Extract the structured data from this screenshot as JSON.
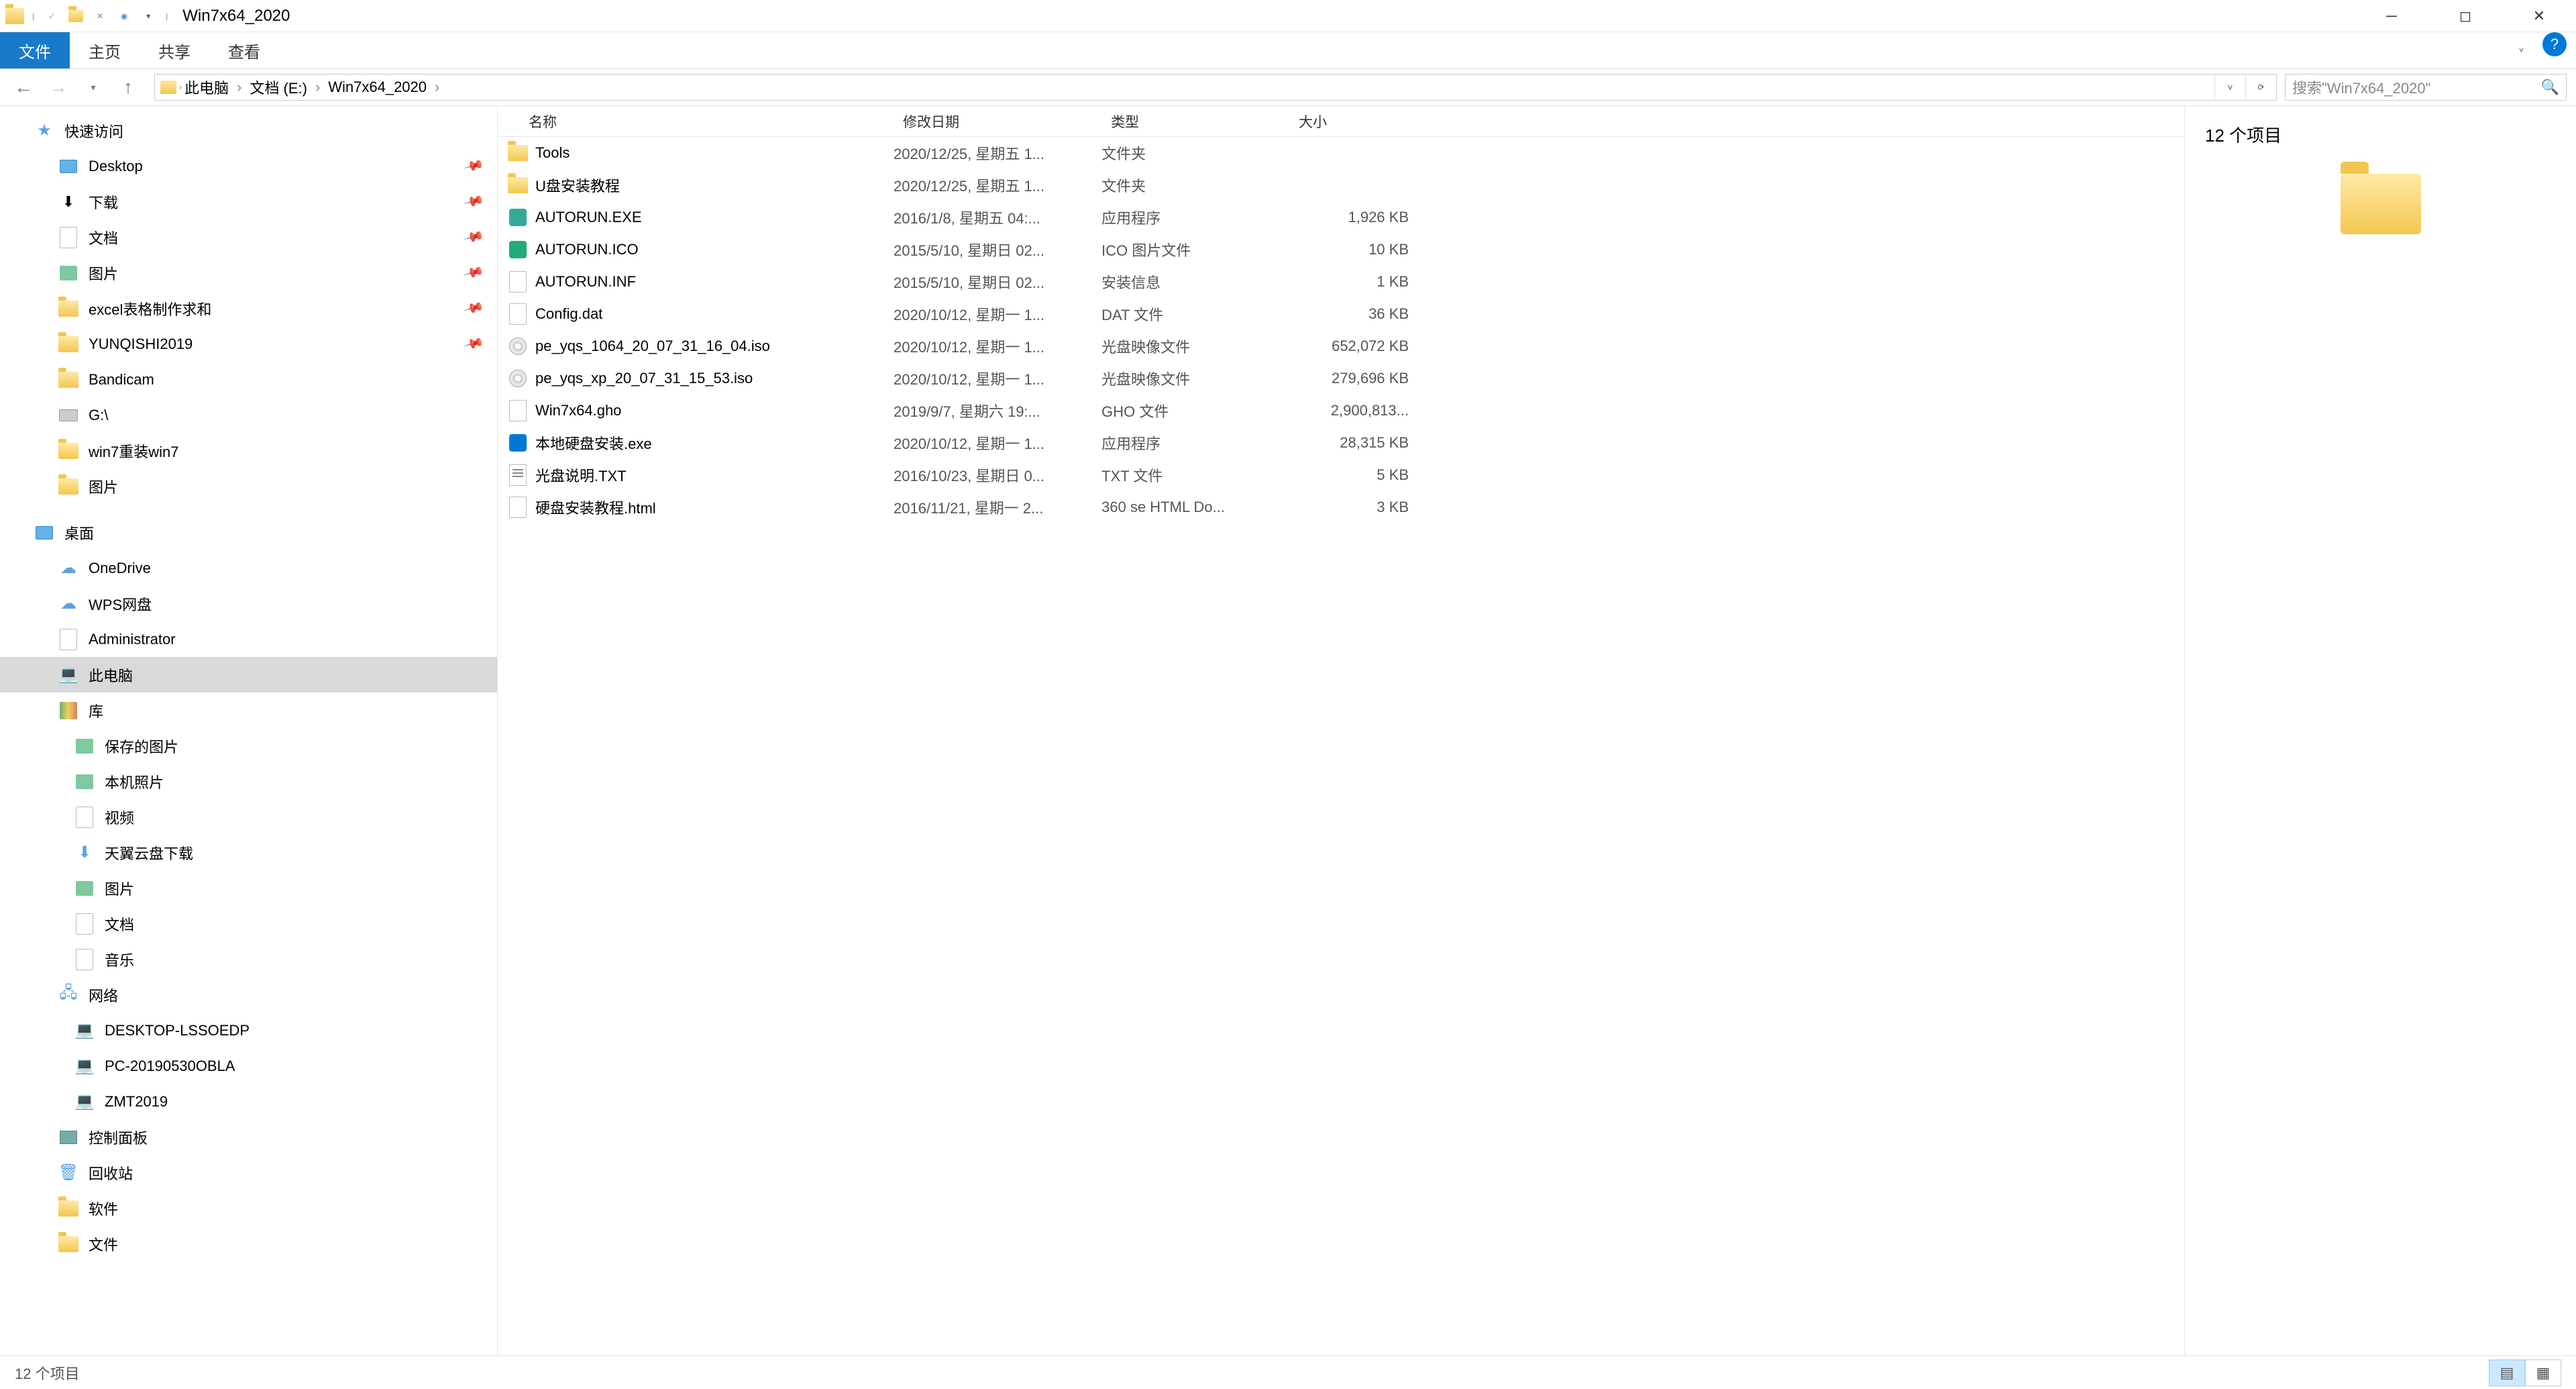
{
  "title": "Win7x64_2020",
  "ribbon": {
    "file": "文件",
    "tabs": [
      "主页",
      "共享",
      "查看"
    ]
  },
  "breadcrumb": [
    "此电脑",
    "文档 (E:)",
    "Win7x64_2020"
  ],
  "search_placeholder": "搜索\"Win7x64_2020\"",
  "columns": {
    "name": "名称",
    "date": "修改日期",
    "type": "类型",
    "size": "大小"
  },
  "nav": {
    "quick": {
      "label": "快速访问",
      "items": [
        {
          "label": "Desktop",
          "pinned": true,
          "ico": "desktop"
        },
        {
          "label": "下载",
          "pinned": true,
          "ico": "dl"
        },
        {
          "label": "文档",
          "pinned": true,
          "ico": "file"
        },
        {
          "label": "图片",
          "pinned": true,
          "ico": "pic"
        },
        {
          "label": "excel表格制作求和",
          "pinned": true,
          "ico": "folder"
        },
        {
          "label": "YUNQISHI2019",
          "pinned": true,
          "ico": "folder"
        },
        {
          "label": "Bandicam",
          "pinned": false,
          "ico": "folder"
        },
        {
          "label": "G:\\",
          "pinned": false,
          "ico": "drive"
        },
        {
          "label": "win7重装win7",
          "pinned": false,
          "ico": "folder"
        },
        {
          "label": "图片",
          "pinned": false,
          "ico": "folder"
        }
      ]
    },
    "desktop": {
      "label": "桌面",
      "items": [
        {
          "label": "OneDrive",
          "ico": "onedrive"
        },
        {
          "label": "WPS网盘",
          "ico": "onedrive"
        },
        {
          "label": "Administrator",
          "ico": "file"
        },
        {
          "label": "此电脑",
          "ico": "pc",
          "selected": true
        },
        {
          "label": "库",
          "ico": "lib",
          "children": [
            {
              "label": "保存的图片",
              "ico": "pic"
            },
            {
              "label": "本机照片",
              "ico": "pic"
            },
            {
              "label": "视频",
              "ico": "file"
            },
            {
              "label": "天翼云盘下载",
              "ico": "dl"
            },
            {
              "label": "图片",
              "ico": "pic"
            },
            {
              "label": "文档",
              "ico": "file"
            },
            {
              "label": "音乐",
              "ico": "file"
            }
          ]
        },
        {
          "label": "网络",
          "ico": "net",
          "children": [
            {
              "label": "DESKTOP-LSSOEDP",
              "ico": "pc"
            },
            {
              "label": "PC-20190530OBLA",
              "ico": "pc"
            },
            {
              "label": "ZMT2019",
              "ico": "pc"
            }
          ]
        },
        {
          "label": "控制面板",
          "ico": "cp"
        },
        {
          "label": "回收站",
          "ico": "recycle"
        },
        {
          "label": "软件",
          "ico": "folder"
        },
        {
          "label": "文件",
          "ico": "folder"
        }
      ]
    }
  },
  "files": [
    {
      "name": "Tools",
      "date": "2020/12/25, 星期五 1...",
      "type": "文件夹",
      "size": "",
      "ico": "folder"
    },
    {
      "name": "U盘安装教程",
      "date": "2020/12/25, 星期五 1...",
      "type": "文件夹",
      "size": "",
      "ico": "folder"
    },
    {
      "name": "AUTORUN.EXE",
      "date": "2016/1/8, 星期五 04:...",
      "type": "应用程序",
      "size": "1,926 KB",
      "ico": "exe"
    },
    {
      "name": "AUTORUN.ICO",
      "date": "2015/5/10, 星期日 02...",
      "type": "ICO 图片文件",
      "size": "10 KB",
      "ico": "ico"
    },
    {
      "name": "AUTORUN.INF",
      "date": "2015/5/10, 星期日 02...",
      "type": "安装信息",
      "size": "1 KB",
      "ico": "file"
    },
    {
      "name": "Config.dat",
      "date": "2020/10/12, 星期一 1...",
      "type": "DAT 文件",
      "size": "36 KB",
      "ico": "file"
    },
    {
      "name": "pe_yqs_1064_20_07_31_16_04.iso",
      "date": "2020/10/12, 星期一 1...",
      "type": "光盘映像文件",
      "size": "652,072 KB",
      "ico": "iso"
    },
    {
      "name": "pe_yqs_xp_20_07_31_15_53.iso",
      "date": "2020/10/12, 星期一 1...",
      "type": "光盘映像文件",
      "size": "279,696 KB",
      "ico": "iso"
    },
    {
      "name": "Win7x64.gho",
      "date": "2019/9/7, 星期六 19:...",
      "type": "GHO 文件",
      "size": "2,900,813...",
      "ico": "gho"
    },
    {
      "name": "本地硬盘安装.exe",
      "date": "2020/10/12, 星期一 1...",
      "type": "应用程序",
      "size": "28,315 KB",
      "ico": "app"
    },
    {
      "name": "光盘说明.TXT",
      "date": "2016/10/23, 星期日 0...",
      "type": "TXT 文件",
      "size": "5 KB",
      "ico": "txt"
    },
    {
      "name": "硬盘安装教程.html",
      "date": "2016/11/21, 星期一 2...",
      "type": "360 se HTML Do...",
      "size": "3 KB",
      "ico": "file"
    }
  ],
  "preview": {
    "title": "12 个项目"
  },
  "status": {
    "text": "12 个项目"
  }
}
